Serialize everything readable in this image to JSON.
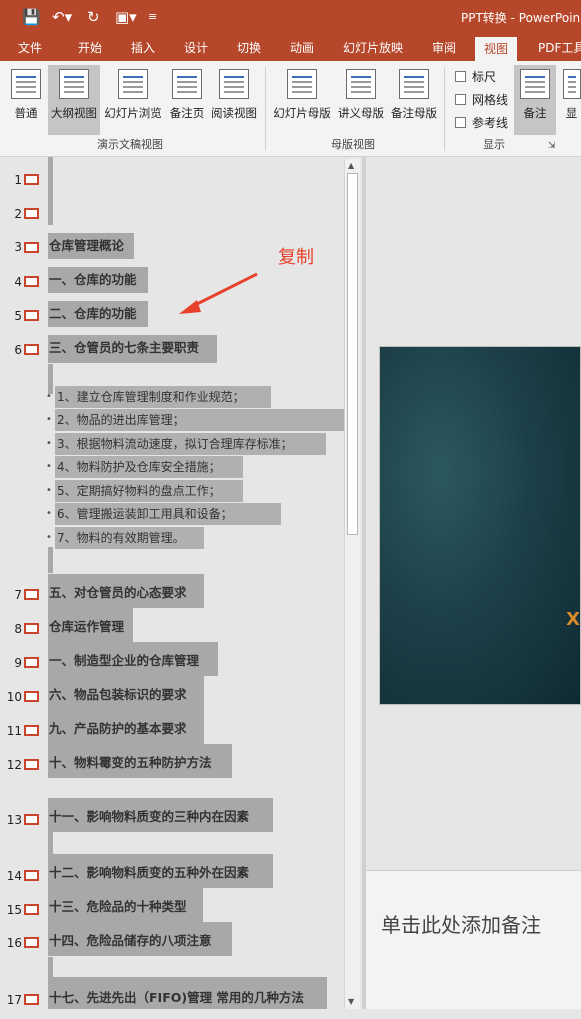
{
  "title": "PPT转换 - PowerPoin",
  "tabs": [
    "文件",
    "开始",
    "插入",
    "设计",
    "切换",
    "动画",
    "幻灯片放映",
    "审阅",
    "视图",
    "PDF工具"
  ],
  "active_tab": "视图",
  "ribbon": {
    "buttons": [
      "普通",
      "大纲视图",
      "幻灯片浏览",
      "备注页",
      "阅读视图",
      "幻灯片母版",
      "讲义母版",
      "备注母版",
      "备注",
      "显"
    ],
    "groups": [
      "演示文稿视图",
      "母版视图",
      "显示"
    ],
    "checks": [
      "标尺",
      "网格线",
      "参考线"
    ]
  },
  "annotation": "复制",
  "slides": [
    {
      "num": "1",
      "title": ""
    },
    {
      "num": "2",
      "title": ""
    },
    {
      "num": "3",
      "title": "仓库管理概论"
    },
    {
      "num": "4",
      "title": "一、仓库的功能"
    },
    {
      "num": "5",
      "title": "二、仓库的功能"
    },
    {
      "num": "6",
      "title": "三、仓管员的七条主要职责"
    },
    {
      "num": "7",
      "title": "五、对仓管员的心态要求"
    },
    {
      "num": "8",
      "title": "仓库运作管理"
    },
    {
      "num": "9",
      "title": "一、制造型企业的仓库管理"
    },
    {
      "num": "10",
      "title": "六、物品包装标识的要求"
    },
    {
      "num": "11",
      "title": "九、产品防护的基本要求"
    },
    {
      "num": "12",
      "title": "十、物料霉变的五种防护方法"
    },
    {
      "num": "13",
      "title": "十一、影响物料质变的三种内在因素"
    },
    {
      "num": "14",
      "title": "十二、影响物料质变的五种外在因素"
    },
    {
      "num": "15",
      "title": "十三、危险品的十种类型"
    },
    {
      "num": "16",
      "title": "十四、危险品储存的八项注意"
    },
    {
      "num": "17",
      "title": "十七、先进先出（FIFO)管理 常用的几种方法"
    }
  ],
  "bullets": [
    "1、建立仓库管理制度和作业规范；",
    "2、物品的进出库管理；",
    "3、根据物料流动速度，拟订合理库存标准；",
    "4、物料防护及仓库安全措施；",
    "5、定期搞好物料的盘点工作；",
    "6、管理搬运装卸工用具和设备；",
    "7、物料的有效期管理。"
  ],
  "notes_placeholder": "单击此处添加备注",
  "slide_text": "X"
}
